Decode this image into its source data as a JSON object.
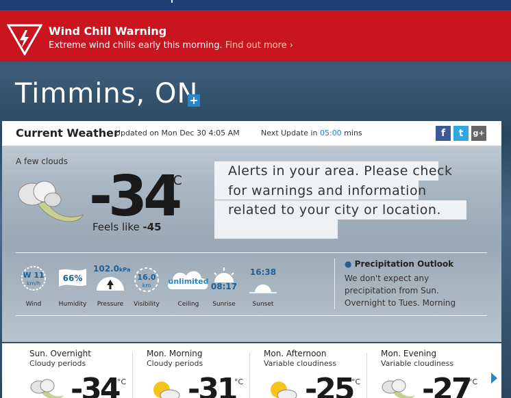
{
  "alert": {
    "title": "Wind Chill Warning",
    "description": "Extreme wind chills early this morning.",
    "link": "Find out more ›",
    "color": "#c8151f"
  },
  "location": {
    "city": "Timmins, ON",
    "add_icon": "plus-icon"
  },
  "current": {
    "heading": "Current Weather",
    "updated": "Updated on Mon Dec 30 4:05 AM",
    "next_update_prefix": "Next Update in",
    "next_update_time": "05:00",
    "next_update_suffix": "mins",
    "condition": "A few clouds",
    "temperature": "-34",
    "unit": "°C",
    "feels_like_label": "Feels like",
    "feels_like_value": "-45",
    "message": "Alerts in your area. Please check for warnings and information related to your city or location."
  },
  "social": [
    {
      "icon": "facebook-icon",
      "glyph": "f",
      "color": "#3b5998"
    },
    {
      "icon": "twitter-icon",
      "glyph": "t",
      "color": "#2fa8e0"
    },
    {
      "icon": "google-plus-icon",
      "glyph": "g+",
      "color": "#666666"
    }
  ],
  "stats": {
    "wind": {
      "label": "Wind",
      "value": "W 11",
      "unit": "km/h"
    },
    "humidity": {
      "label": "Humidity",
      "value": "66%"
    },
    "pressure": {
      "label": "Pressure",
      "value": "102.0",
      "unit": "kPa"
    },
    "visibility": {
      "label": "Visibility",
      "value": "16.0",
      "unit": "km"
    },
    "ceiling": {
      "label": "Ceiling",
      "value": "unlimited"
    },
    "sunrise": {
      "label": "Sunrise",
      "value": "08:17"
    },
    "sunset": {
      "label": "Sunset",
      "value": "16:38"
    }
  },
  "precipitation": {
    "title": "Precipitation Outlook",
    "body": "We don't expect any precipitation from Sun. Overnight to Tues. Morning"
  },
  "forecast": [
    {
      "period": "Sun. Overnight",
      "desc": "Cloudy periods",
      "temp": "-34",
      "unit": "°C",
      "icon": "cloudy-night-icon"
    },
    {
      "period": "Mon. Morning",
      "desc": "Cloudy periods",
      "temp": "-31",
      "unit": "°C",
      "icon": "sun-cloud-icon"
    },
    {
      "period": "Mon. Afternoon",
      "desc": "Variable cloudiness",
      "temp": "-25",
      "unit": "°C",
      "icon": "sun-cloud-icon"
    },
    {
      "period": "Mon. Evening",
      "desc": "Variable cloudiness",
      "temp": "-27",
      "unit": "°C",
      "icon": "cloudy-night-icon"
    }
  ]
}
